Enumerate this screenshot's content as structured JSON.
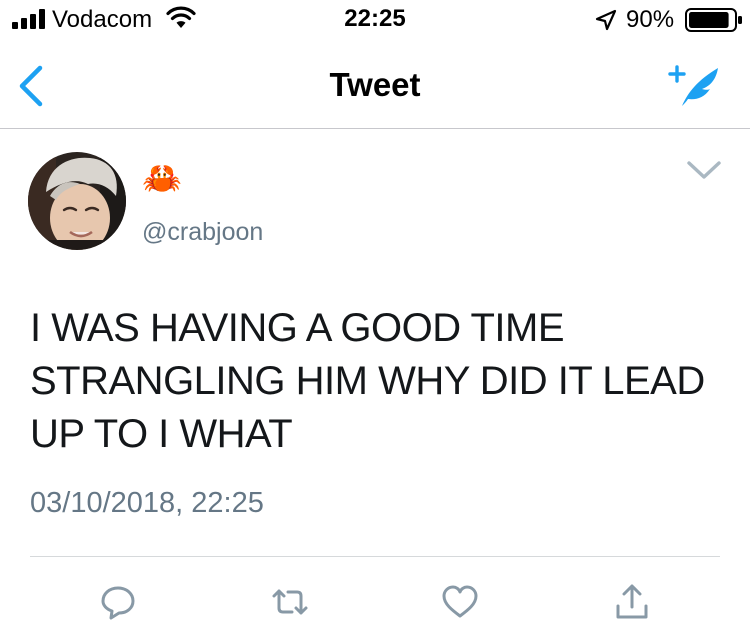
{
  "status_bar": {
    "carrier": "Vodacom",
    "time": "22:25",
    "battery_percent": "90%",
    "battery_level": 0.9,
    "icons": [
      "signal-bars-icon",
      "wifi-icon",
      "location-arrow-icon",
      "battery-icon"
    ]
  },
  "nav": {
    "title": "Tweet",
    "back_icon": "chevron-left-icon",
    "compose_icon": "compose-feather-icon"
  },
  "tweet": {
    "display_name": "🦀",
    "handle": "@crabjoon",
    "text": "I WAS HAVING A GOOD TIME STRANGLING HIM WHY DID IT LEAD UP TO I WHAT",
    "timestamp": "03/10/2018, 22:25"
  },
  "actions": [
    "reply-icon",
    "retweet-icon",
    "like-icon",
    "share-icon"
  ],
  "colors": {
    "accent": "#1da1f2",
    "secondary_text": "#657786",
    "icon_gray": "#8899a6",
    "divider": "#d6d9db"
  }
}
